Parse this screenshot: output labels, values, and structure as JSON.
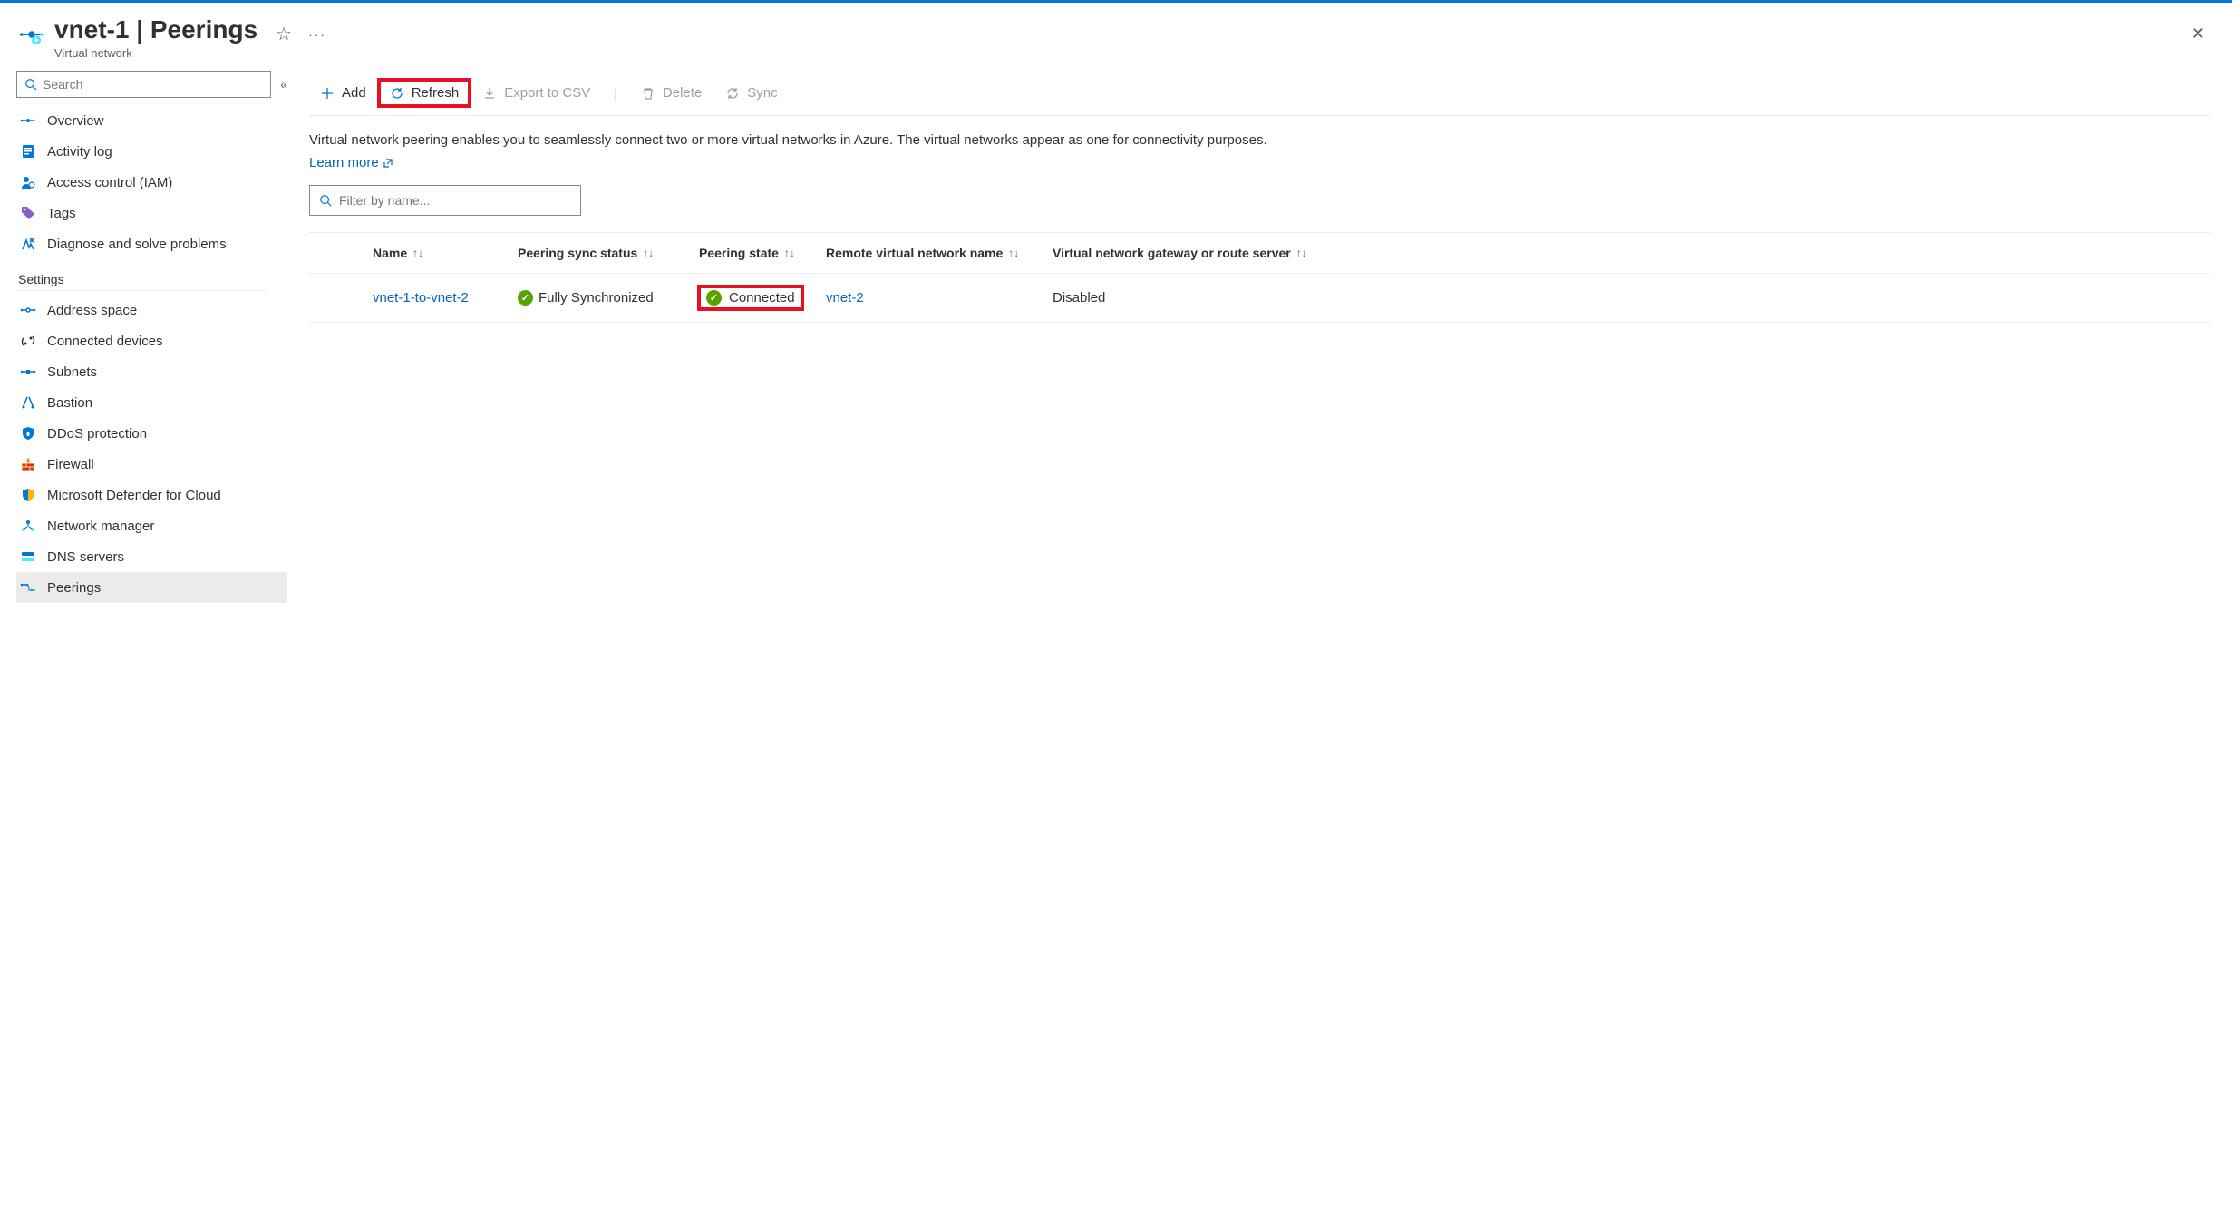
{
  "header": {
    "title": "vnet-1 | Peerings",
    "subtitle": "Virtual network"
  },
  "sidebar": {
    "search_placeholder": "Search",
    "items_top": [
      {
        "label": "Overview"
      },
      {
        "label": "Activity log"
      },
      {
        "label": "Access control (IAM)"
      },
      {
        "label": "Tags"
      },
      {
        "label": "Diagnose and solve problems"
      }
    ],
    "section": "Settings",
    "items_settings": [
      {
        "label": "Address space"
      },
      {
        "label": "Connected devices"
      },
      {
        "label": "Subnets"
      },
      {
        "label": "Bastion"
      },
      {
        "label": "DDoS protection"
      },
      {
        "label": "Firewall"
      },
      {
        "label": "Microsoft Defender for Cloud"
      },
      {
        "label": "Network manager"
      },
      {
        "label": "DNS servers"
      },
      {
        "label": "Peerings"
      }
    ]
  },
  "toolbar": {
    "add": "Add",
    "refresh": "Refresh",
    "export": "Export to CSV",
    "delete": "Delete",
    "sync": "Sync"
  },
  "description": "Virtual network peering enables you to seamlessly connect two or more virtual networks in Azure. The virtual networks appear as one for connectivity purposes.",
  "learn_more": "Learn more",
  "filter_placeholder": "Filter by name...",
  "table": {
    "columns": {
      "name": "Name",
      "sync": "Peering sync status",
      "state": "Peering state",
      "remote": "Remote virtual network name",
      "gateway": "Virtual network gateway or route server"
    },
    "rows": [
      {
        "name": "vnet-1-to-vnet-2",
        "sync": "Fully Synchronized",
        "state": "Connected",
        "remote": "vnet-2",
        "gateway": "Disabled"
      }
    ]
  }
}
